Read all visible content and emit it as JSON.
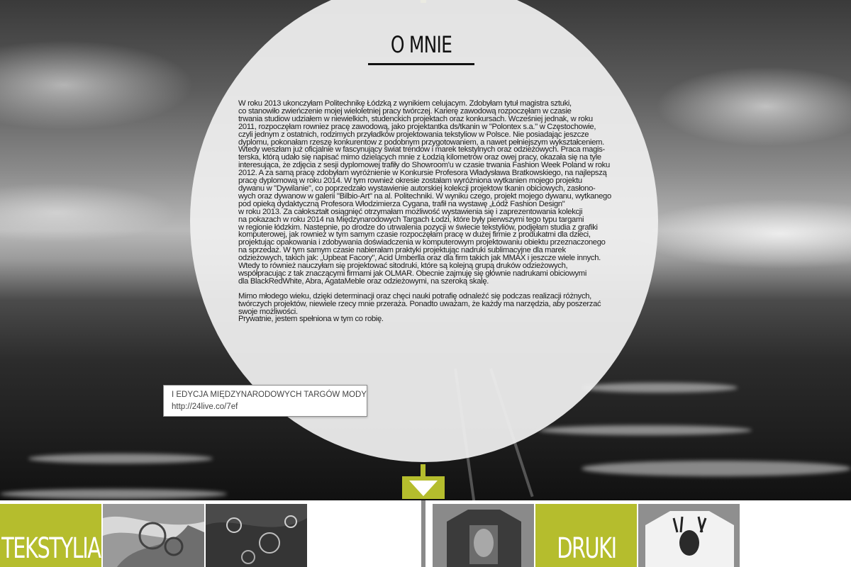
{
  "section": {
    "title": "O MNIE"
  },
  "article": {
    "paragraphs": [
      [
        "W roku 2013 ukonczyłam Politechnikę Łódzką z wynikiem celujacym. Zdobyłam tytuł magistra sztuki,",
        "co stanowiło zwieńczenie mojej wieloletniej pracy twórczej. Karierę zawodową rozpoczęłam w czasie",
        "trwania studiow udziałem w niewielkich, studenckich projektach oraz konkursach. Wcześniej jednak, w roku",
        "2011, rozpoczęłam rowniez pracę zawodową, jako projektantka ds/tkanin w \"Polontex s.a.\" w Częstochowie,",
        "czyli jednym z ostatnich, rodzimych przyładków projektowania tekstyliow w Polsce. Nie posiadając jeszcze",
        "dyplomu, pokonałam rzeszę konkurentow z podobnym przygotowaniem, a nawet pełniejszym wykształceniem.",
        "Wtedy weszłam już oficjalnie w fascynujący świat trendow i marek tekstylnych oraz odzieżowych. Praca magis-",
        "terska, którą udało się napisać mimo dzielących mnie z Łodzią kilometrów oraz owej pracy, okazała się na tyle",
        "interesująca, że zdjęcia z sesji dyplomowej trafiły do Showroom'u w czasie trwania Fashion Week Poland w roku",
        "2012. A za samą pracę zdobyłam wyróżnienie w Konkursie Profesora Władysława Bratkowskiego, na najlepszą",
        "pracę dyplomową w roku 2014. W tym rownież okresie zostałam wyróżniona wytkanien mojego projektu",
        "dywanu w \"Dywilanie\", co poprzedzało wystawienie autorskiej kolekcji projektow tkanin obiciowych, zasłono-",
        "wych oraz dywanow w galerii \"Bilbio-Art\" na al. Politechniki. W wyniku czego, projekt mojego dywanu, wytkanego",
        "pod opieką dydaktyczną Profesora Włodzimierza Cygana, trafił na wystawę „Łódź Fashion Design\"",
        "w roku 2013. Za całokształt osiągnięć otrzymałam możliwość wystawienia się i zaprezentowania kolekcji",
        "na pokazach w roku 2014 na Międzynarodowych Targach Łodzi, które były pierwszymi tego typu targami",
        "w regionie łódzkim. Nastepnie, po drodze do utrwalenia pozycji w świecie tekstyliów, podjęłam studia z grafiki",
        "komputerowej, jak rownież w tym samym czasie rozpoczęłam pracę w dużej firmie z produkatmi dla dzieci,",
        "projektując opakowania i zdobywania doświadczenia w komputerowym projektowaniu obiektu przeznaczonego",
        "na sprzedaż. W tym samym czasie nabierałam praktyki projektując nadruki sublimacyjne dla marek",
        "odzieżowych, takich jak: „Upbeat Facory\", Acid Umberlla oraz dla firm takich jak MMAX i jeszcze wiele innych.",
        "Wtedy to również nauczyłam się projektować sitodruki, które są kolejną grupą druków odzieżowych,",
        "współpracując z tak znaczącymi firmami jak OLMAR. Obecnie zajmuję się głównie nadrukami obiciowymi",
        "dla BlackRedWhite, Abra, AgataMeble oraz odzieżowymi, na szeroką skalę."
      ],
      [
        "Mimo młodego wieku, dzięki determinacji oraz chęci nauki potrafię odnaleźć się podczas realizacji różnych,",
        "twórczych projektów, niewiele rzecy mnie przeraża. Ponadto uważam, że każdy ma narzędzia, aby poszerzać",
        "swoje możliwości.",
        "Prywatnie, jestem spełniona w tym co robię."
      ]
    ]
  },
  "tooltip": {
    "title": "I EDYCJA MIĘDZYNARODOWYCH TARGÓW MODY",
    "url": "http://24live.co/7ef"
  },
  "scroll_arrow": {
    "icon": "arrow-down-icon"
  },
  "categories": [
    {
      "label": "TEKSTYLIA"
    },
    {
      "label": "DRUKI"
    }
  ],
  "colors": {
    "accent": "#b5bd2d",
    "divider": "#8a8a8a",
    "text": "#1a1a1a"
  }
}
